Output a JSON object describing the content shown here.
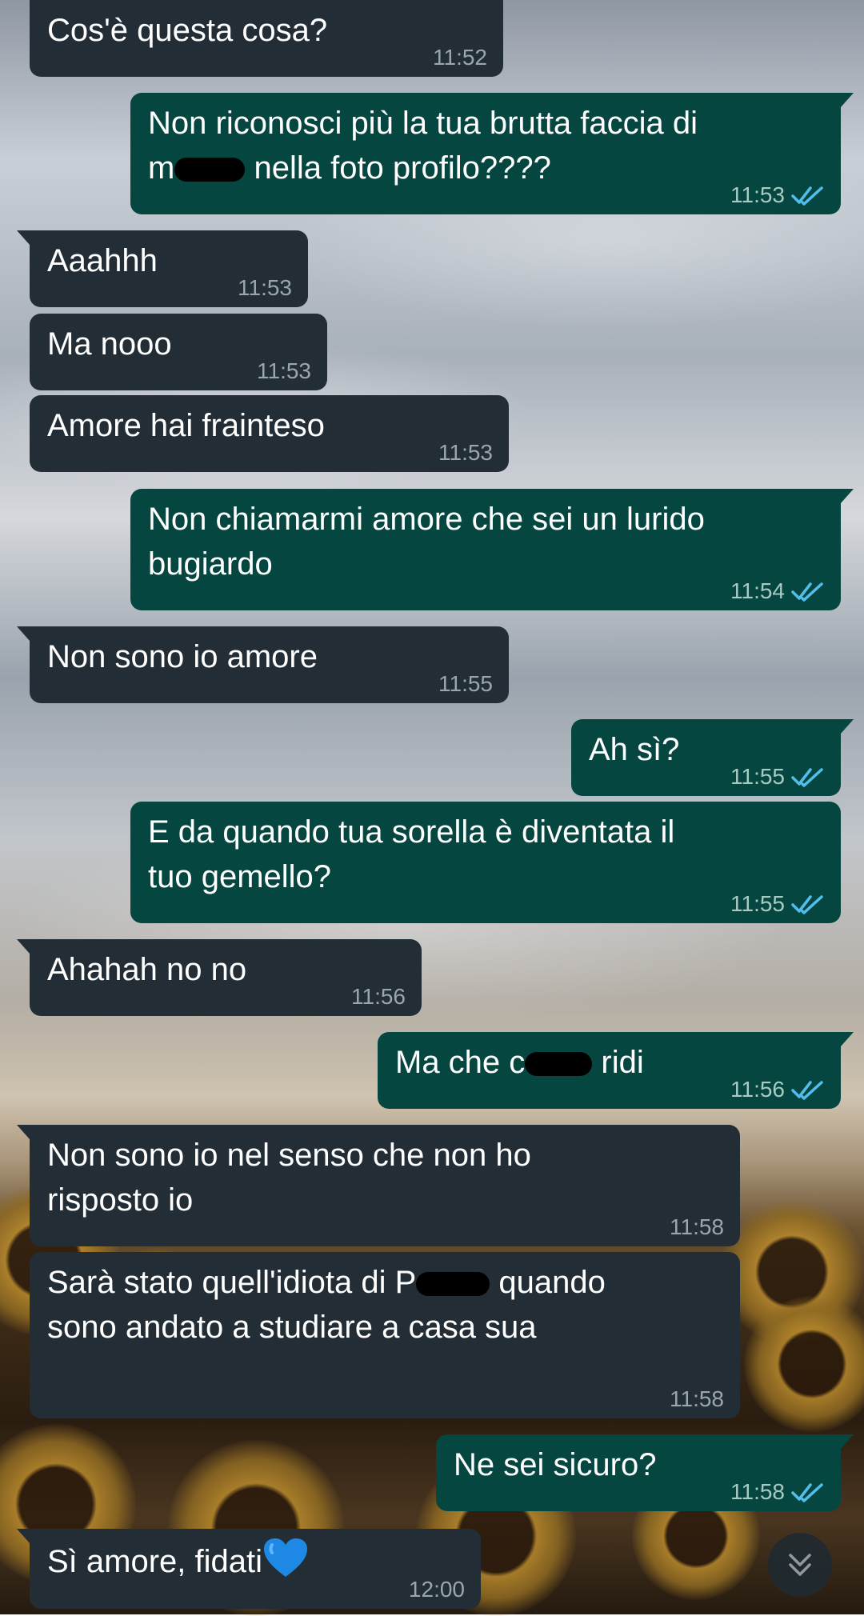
{
  "colors": {
    "incoming_bubble": "#232d36",
    "outgoing_bubble": "#054740",
    "read_ticks": "#53bdeb",
    "heart": "#1e88e5"
  },
  "messages": [
    {
      "dir": "in",
      "text": "Cos'è questa cosa?",
      "time": "11:52"
    },
    {
      "dir": "out",
      "text_line1": "Non riconosci più la tua brutta faccia di",
      "text_line2a": "m",
      "text_line2b": "nella foto profilo????",
      "time": "11:53",
      "status": "read"
    },
    {
      "dir": "in",
      "text": "Aaahhh",
      "time": "11:53"
    },
    {
      "dir": "in",
      "text": "Ma nooo",
      "time": "11:53"
    },
    {
      "dir": "in",
      "text": "Amore hai frainteso",
      "time": "11:53"
    },
    {
      "dir": "out",
      "text": "Non chiamarmi amore che sei un lurido\nbugiardo",
      "time": "11:54",
      "status": "read"
    },
    {
      "dir": "in",
      "text": "Non sono io amore",
      "time": "11:55"
    },
    {
      "dir": "out",
      "text": "Ah sì?",
      "time": "11:55",
      "status": "read"
    },
    {
      "dir": "out",
      "text": "E da quando tua sorella è diventata il\ntuo gemello?",
      "time": "11:55",
      "status": "read"
    },
    {
      "dir": "in",
      "text": "Ahahah no no",
      "time": "11:56"
    },
    {
      "dir": "out",
      "text_a": "Ma che c",
      "text_b": "ridi",
      "time": "11:56",
      "status": "read"
    },
    {
      "dir": "in",
      "text": "Non sono io nel senso che non ho\nrisposto io",
      "time": "11:58"
    },
    {
      "dir": "in",
      "text_line1a": "Sarà stato quell'idiota di P",
      "text_line1b": "quando",
      "text_line2": "sono andato a studiare a casa sua",
      "time": "11:58"
    },
    {
      "dir": "out",
      "text": "Ne sei sicuro?",
      "time": "11:58",
      "status": "read"
    },
    {
      "dir": "in",
      "text": "Sì amore, fidati",
      "emoji": "blue-heart",
      "time": "12:00"
    }
  ],
  "scroll_down_button": {
    "icon": "double-chevron-down-icon"
  }
}
